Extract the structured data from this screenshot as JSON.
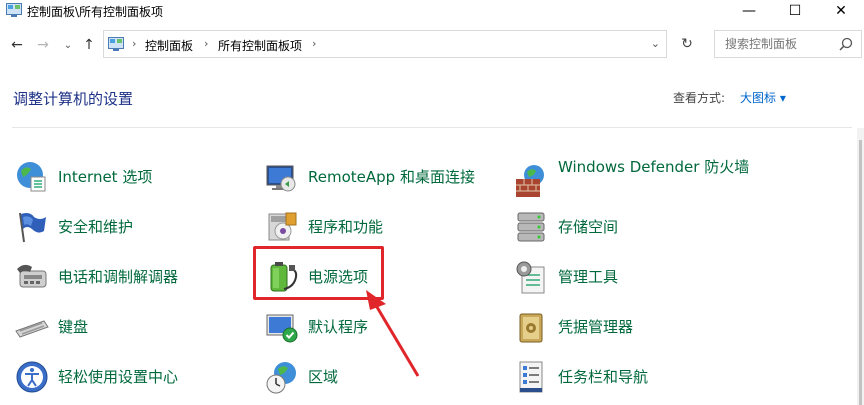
{
  "window": {
    "title": "控制面板\\所有控制面板项",
    "min_glyph": "—",
    "max_glyph": "☐",
    "close_glyph": "✕"
  },
  "nav": {
    "back_glyph": "←",
    "forward_glyph": "→",
    "recent_glyph": "⌄",
    "up_glyph": "↑",
    "refresh_glyph": "↻"
  },
  "address": {
    "crumbs": [
      "控制面板",
      "所有控制面板项"
    ],
    "sep": "›",
    "dropdown": "⌄"
  },
  "search": {
    "placeholder": "搜索控制面板"
  },
  "main": {
    "heading": "调整计算机的设置",
    "view_label": "查看方式:",
    "view_value": "大图标 ▾"
  },
  "items": [
    {
      "label": "Internet 选项",
      "icon": "internet-options-icon"
    },
    {
      "label": "RemoteApp 和桌面连接",
      "icon": "remoteapp-icon"
    },
    {
      "label": "Windows Defender 防火墙",
      "icon": "firewall-icon"
    },
    {
      "label": "安全和维护",
      "icon": "security-flag-icon"
    },
    {
      "label": "程序和功能",
      "icon": "programs-icon"
    },
    {
      "label": "存储空间",
      "icon": "storage-icon"
    },
    {
      "label": "电话和调制解调器",
      "icon": "phone-modem-icon"
    },
    {
      "label": "电源选项",
      "icon": "power-options-icon"
    },
    {
      "label": "管理工具",
      "icon": "admin-tools-icon"
    },
    {
      "label": "键盘",
      "icon": "keyboard-icon"
    },
    {
      "label": "默认程序",
      "icon": "default-programs-icon"
    },
    {
      "label": "凭据管理器",
      "icon": "credential-manager-icon"
    },
    {
      "label": "轻松使用设置中心",
      "icon": "ease-of-access-icon"
    },
    {
      "label": "区域",
      "icon": "region-icon"
    },
    {
      "label": "任务栏和导航",
      "icon": "taskbar-icon"
    }
  ],
  "colors": {
    "link_green": "#00693c",
    "heading_blue": "#1e3287",
    "highlight_red": "#e0262a"
  }
}
